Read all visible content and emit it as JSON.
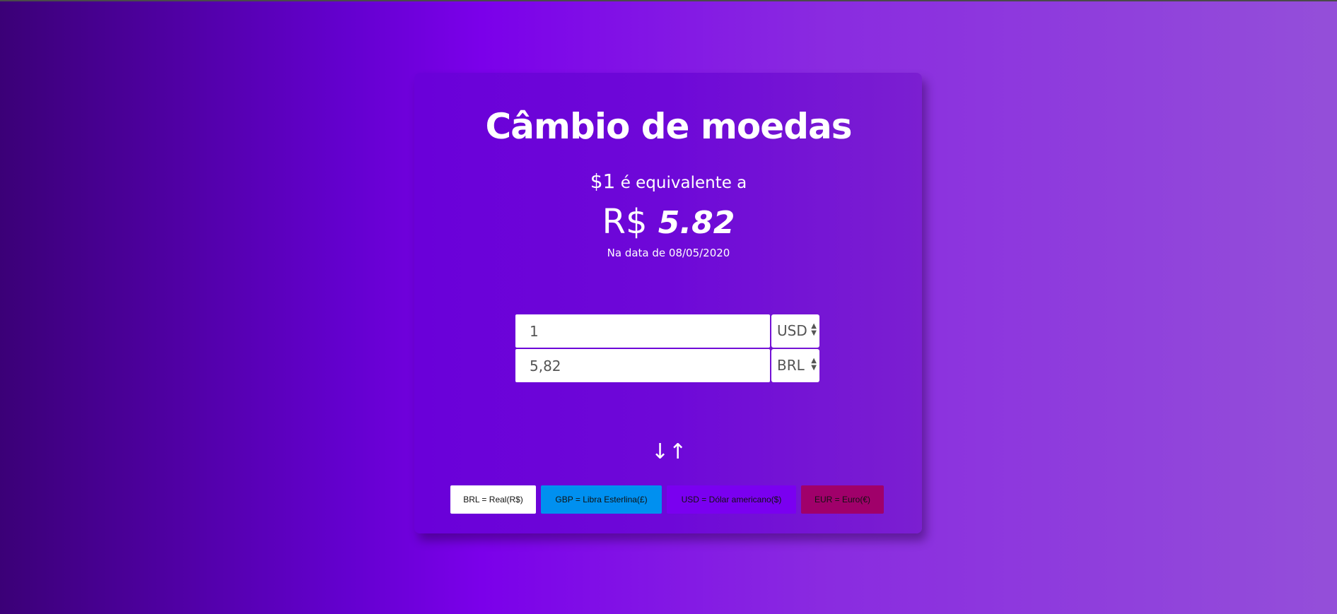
{
  "header": {
    "title": "Câmbio de moedas"
  },
  "summary": {
    "amount_symbol": "$1",
    "equivalent_text": "é equivalente a",
    "target_symbol": "R$",
    "rate_value": "5.82",
    "date_text": "Na data de 08/05/2020"
  },
  "converter": {
    "from_value": "1",
    "from_currency": "USD",
    "to_value": "5,82",
    "to_currency": "BRL",
    "swap_label": "↓↑"
  },
  "legend": [
    {
      "label": "BRL = Real(R$)",
      "color": "#ffffff"
    },
    {
      "label": "GBP = Libra Esterlina(£)",
      "color": "#0090f0"
    },
    {
      "label": "USD = Dólar americano($)",
      "color": "#7a00f0"
    },
    {
      "label": "EUR = Euro(€)",
      "color": "#a0006a"
    }
  ],
  "colors": {
    "background_start": "#3b0077",
    "background_mid": "#7b00ea",
    "background_end": "#944fd9",
    "card": "#6e08d8"
  }
}
